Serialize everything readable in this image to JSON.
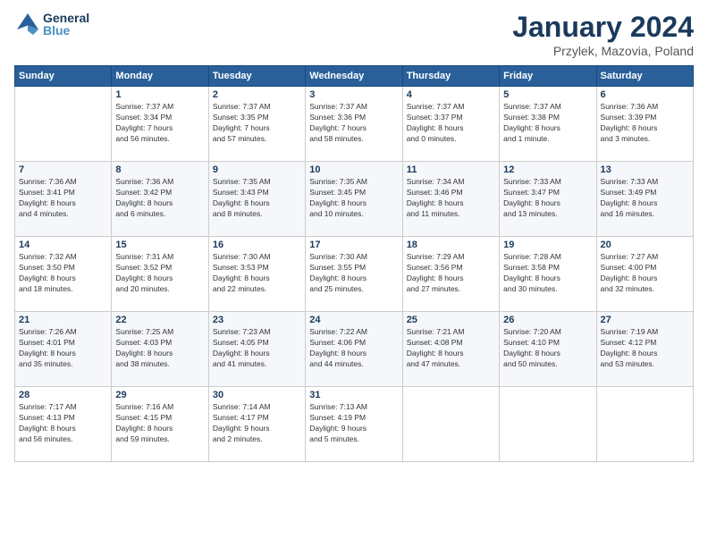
{
  "logo": {
    "line1": "General",
    "line2": "Blue"
  },
  "title": "January 2024",
  "subtitle": "Przylek, Mazovia, Poland",
  "weekdays": [
    "Sunday",
    "Monday",
    "Tuesday",
    "Wednesday",
    "Thursday",
    "Friday",
    "Saturday"
  ],
  "weeks": [
    [
      {
        "day": "",
        "info": ""
      },
      {
        "day": "1",
        "info": "Sunrise: 7:37 AM\nSunset: 3:34 PM\nDaylight: 7 hours\nand 56 minutes."
      },
      {
        "day": "2",
        "info": "Sunrise: 7:37 AM\nSunset: 3:35 PM\nDaylight: 7 hours\nand 57 minutes."
      },
      {
        "day": "3",
        "info": "Sunrise: 7:37 AM\nSunset: 3:36 PM\nDaylight: 7 hours\nand 58 minutes."
      },
      {
        "day": "4",
        "info": "Sunrise: 7:37 AM\nSunset: 3:37 PM\nDaylight: 8 hours\nand 0 minutes."
      },
      {
        "day": "5",
        "info": "Sunrise: 7:37 AM\nSunset: 3:38 PM\nDaylight: 8 hours\nand 1 minute."
      },
      {
        "day": "6",
        "info": "Sunrise: 7:36 AM\nSunset: 3:39 PM\nDaylight: 8 hours\nand 3 minutes."
      }
    ],
    [
      {
        "day": "7",
        "info": "Sunrise: 7:36 AM\nSunset: 3:41 PM\nDaylight: 8 hours\nand 4 minutes."
      },
      {
        "day": "8",
        "info": "Sunrise: 7:36 AM\nSunset: 3:42 PM\nDaylight: 8 hours\nand 6 minutes."
      },
      {
        "day": "9",
        "info": "Sunrise: 7:35 AM\nSunset: 3:43 PM\nDaylight: 8 hours\nand 8 minutes."
      },
      {
        "day": "10",
        "info": "Sunrise: 7:35 AM\nSunset: 3:45 PM\nDaylight: 8 hours\nand 10 minutes."
      },
      {
        "day": "11",
        "info": "Sunrise: 7:34 AM\nSunset: 3:46 PM\nDaylight: 8 hours\nand 11 minutes."
      },
      {
        "day": "12",
        "info": "Sunrise: 7:33 AM\nSunset: 3:47 PM\nDaylight: 8 hours\nand 13 minutes."
      },
      {
        "day": "13",
        "info": "Sunrise: 7:33 AM\nSunset: 3:49 PM\nDaylight: 8 hours\nand 16 minutes."
      }
    ],
    [
      {
        "day": "14",
        "info": "Sunrise: 7:32 AM\nSunset: 3:50 PM\nDaylight: 8 hours\nand 18 minutes."
      },
      {
        "day": "15",
        "info": "Sunrise: 7:31 AM\nSunset: 3:52 PM\nDaylight: 8 hours\nand 20 minutes."
      },
      {
        "day": "16",
        "info": "Sunrise: 7:30 AM\nSunset: 3:53 PM\nDaylight: 8 hours\nand 22 minutes."
      },
      {
        "day": "17",
        "info": "Sunrise: 7:30 AM\nSunset: 3:55 PM\nDaylight: 8 hours\nand 25 minutes."
      },
      {
        "day": "18",
        "info": "Sunrise: 7:29 AM\nSunset: 3:56 PM\nDaylight: 8 hours\nand 27 minutes."
      },
      {
        "day": "19",
        "info": "Sunrise: 7:28 AM\nSunset: 3:58 PM\nDaylight: 8 hours\nand 30 minutes."
      },
      {
        "day": "20",
        "info": "Sunrise: 7:27 AM\nSunset: 4:00 PM\nDaylight: 8 hours\nand 32 minutes."
      }
    ],
    [
      {
        "day": "21",
        "info": "Sunrise: 7:26 AM\nSunset: 4:01 PM\nDaylight: 8 hours\nand 35 minutes."
      },
      {
        "day": "22",
        "info": "Sunrise: 7:25 AM\nSunset: 4:03 PM\nDaylight: 8 hours\nand 38 minutes."
      },
      {
        "day": "23",
        "info": "Sunrise: 7:23 AM\nSunset: 4:05 PM\nDaylight: 8 hours\nand 41 minutes."
      },
      {
        "day": "24",
        "info": "Sunrise: 7:22 AM\nSunset: 4:06 PM\nDaylight: 8 hours\nand 44 minutes."
      },
      {
        "day": "25",
        "info": "Sunrise: 7:21 AM\nSunset: 4:08 PM\nDaylight: 8 hours\nand 47 minutes."
      },
      {
        "day": "26",
        "info": "Sunrise: 7:20 AM\nSunset: 4:10 PM\nDaylight: 8 hours\nand 50 minutes."
      },
      {
        "day": "27",
        "info": "Sunrise: 7:19 AM\nSunset: 4:12 PM\nDaylight: 8 hours\nand 53 minutes."
      }
    ],
    [
      {
        "day": "28",
        "info": "Sunrise: 7:17 AM\nSunset: 4:13 PM\nDaylight: 8 hours\nand 56 minutes."
      },
      {
        "day": "29",
        "info": "Sunrise: 7:16 AM\nSunset: 4:15 PM\nDaylight: 8 hours\nand 59 minutes."
      },
      {
        "day": "30",
        "info": "Sunrise: 7:14 AM\nSunset: 4:17 PM\nDaylight: 9 hours\nand 2 minutes."
      },
      {
        "day": "31",
        "info": "Sunrise: 7:13 AM\nSunset: 4:19 PM\nDaylight: 9 hours\nand 5 minutes."
      },
      {
        "day": "",
        "info": ""
      },
      {
        "day": "",
        "info": ""
      },
      {
        "day": "",
        "info": ""
      }
    ]
  ]
}
